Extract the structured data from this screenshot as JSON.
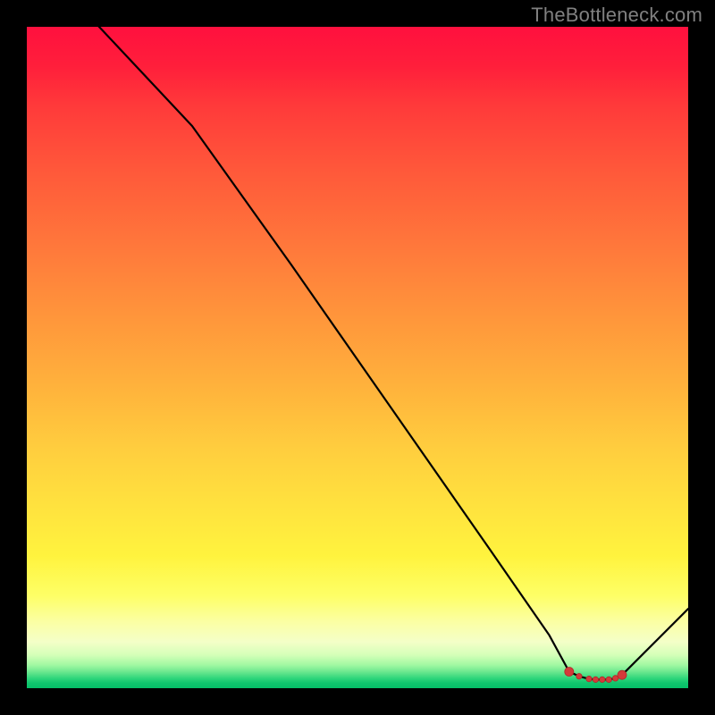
{
  "watermark": "TheBottleneck.com",
  "colors": {
    "background": "#000000",
    "line": "#000000",
    "marker_fill": "#d43a3a",
    "marker_stroke": "#b22a2a",
    "watermark": "#808080"
  },
  "chart_data": {
    "type": "line",
    "title": "",
    "xlabel": "",
    "ylabel": "",
    "xlim": [
      0,
      100
    ],
    "ylim": [
      0,
      100
    ],
    "x": [
      0,
      10,
      25,
      40,
      55,
      70,
      79,
      82,
      83.5,
      85,
      86,
      87,
      88,
      89,
      90,
      100
    ],
    "values": [
      110,
      101,
      85,
      64,
      42.5,
      21,
      8,
      2.5,
      1.8,
      1.4,
      1.3,
      1.3,
      1.3,
      1.5,
      2,
      12
    ],
    "markers_x": [
      82,
      83.5,
      85,
      86,
      87,
      88,
      89,
      90
    ],
    "markers_y": [
      2.5,
      1.8,
      1.4,
      1.3,
      1.3,
      1.3,
      1.5,
      2
    ],
    "comment": "y-axis is a percentage-like cost metric; large values = red, near-zero = green. Values read by eye from the gradient band positions."
  }
}
